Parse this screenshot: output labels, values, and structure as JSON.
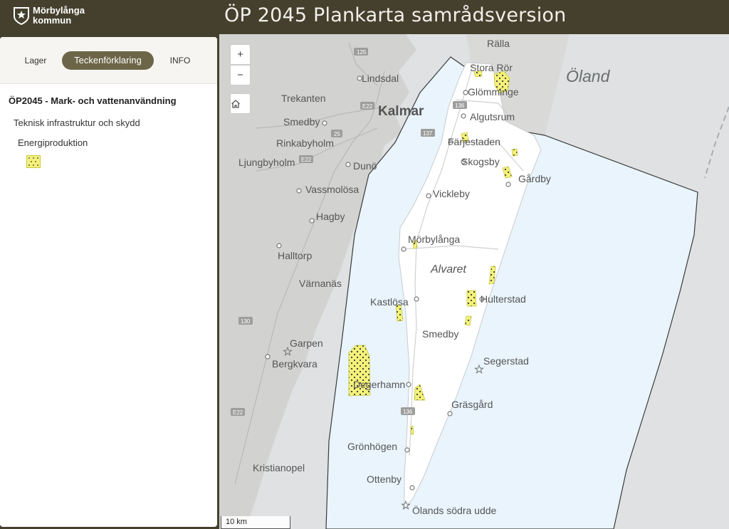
{
  "header": {
    "logo_line1": "Mörbylånga",
    "logo_line2": "kommun",
    "title": "ÖP 2045  Plankarta samrådsversion"
  },
  "panel": {
    "tabs": [
      {
        "label": "Lager"
      },
      {
        "label": "Teckenförklaring",
        "active": true
      },
      {
        "label": "INFO"
      }
    ],
    "legend": {
      "title": "ÖP2045 - Mark- och vattenanvändning",
      "group": "Teknisk infrastruktur och skydd",
      "subgroup": "Energiproduktion",
      "swatch_color": "#f4f27a"
    }
  },
  "map": {
    "controls": {
      "zoom_in": "+",
      "zoom_out": "−",
      "home": "home-icon"
    },
    "scale": "10 km",
    "labels": {
      "ralla": "Rälla",
      "oland": "Öland",
      "stora_ror": "Stora Rör",
      "glomminge": "Glömminge",
      "lindsdal": "Lindsdal",
      "trekanten": "Trekanten",
      "kalmar": "Kalmar",
      "algutsrum": "Algutsrum",
      "smedby_n": "Smedby",
      "farjestaden": "Färjestaden",
      "rinkabyholm": "Rinkabyholm",
      "skogsby": "Skogsby",
      "ljungbyholm": "Ljungbyholm",
      "duno": "Dunö",
      "gardby": "Gårdby",
      "vassmolosa": "Vassmolösa",
      "vickleby": "Vickleby",
      "hagby": "Hagby",
      "morbylanga": "Mörbylånga",
      "halltorp": "Halltorp",
      "alvaret": "Alvaret",
      "varnanas": "Värnanäs",
      "kastlosa": "Kastlösa",
      "hulterstad": "Hulterstad",
      "smedby_s": "Smedby",
      "garpen": "Garpen",
      "bergkvara": "Bergkvara",
      "segerstad": "Segerstad",
      "degerhamn": "Degerhamn",
      "grasgard": "Gräsgård",
      "gronhogen": "Grönhögen",
      "kristianopel": "Kristianopel",
      "ottenby": "Ottenby",
      "olands_sodra_udde": "Ölands södra udde",
      "road_e22_a": "E22",
      "road_e22_b": "E22",
      "road_e22_c": "E22",
      "road_136_a": "136",
      "road_136_b": "136",
      "road_137": "137",
      "road_125": "125",
      "road_25": "25",
      "road_130": "130"
    },
    "colors": {
      "sea_plan": "#e9f4fc",
      "sea": "#dfe1e2",
      "land": "#d2d3d1",
      "oland_land": "#ffffff",
      "energy": "#f4f27a",
      "boundary": "#3a3a3a"
    }
  }
}
